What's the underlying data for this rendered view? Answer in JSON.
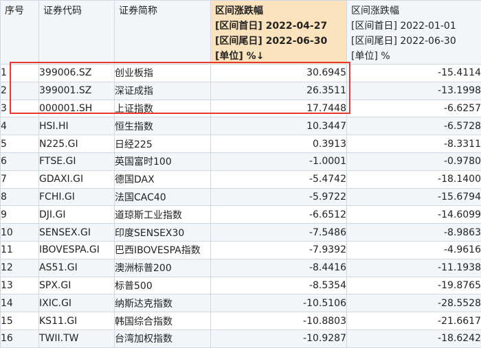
{
  "headers": {
    "idx": "序号",
    "code": "证券代码",
    "name": "证券简称",
    "col1": [
      "区间涨跌幅",
      "[区间首日] 2022-04-27",
      "[区间尾日] 2022-06-30",
      "[单位] %↓"
    ],
    "col2": [
      "区间涨跌幅",
      "[区间首日] 2022-01-01",
      "[区间尾日] 2022-06-30",
      "[单位] %"
    ]
  },
  "rows": [
    {
      "idx": "1",
      "code": "399006.SZ",
      "name": "创业板指",
      "v1": "30.6945",
      "v2": "-15.4114"
    },
    {
      "idx": "2",
      "code": "399001.SZ",
      "name": "深证成指",
      "v1": "26.3511",
      "v2": "-13.1998"
    },
    {
      "idx": "3",
      "code": "000001.SH",
      "name": "上证指数",
      "v1": "17.7448",
      "v2": "-6.6257"
    },
    {
      "idx": "4",
      "code": "HSI.HI",
      "name": "恒生指数",
      "v1": "10.3447",
      "v2": "-6.5728"
    },
    {
      "idx": "5",
      "code": "N225.GI",
      "name": "日经225",
      "v1": "0.3913",
      "v2": "-8.3311"
    },
    {
      "idx": "6",
      "code": "FTSE.GI",
      "name": "英国富时100",
      "v1": "-1.0001",
      "v2": "-0.9780"
    },
    {
      "idx": "7",
      "code": "GDAXI.GI",
      "name": "德国DAX",
      "v1": "-5.4742",
      "v2": "-18.1400"
    },
    {
      "idx": "8",
      "code": "FCHI.GI",
      "name": "法国CAC40",
      "v1": "-5.9722",
      "v2": "-15.6794"
    },
    {
      "idx": "9",
      "code": "DJI.GI",
      "name": "道琼斯工业指数",
      "v1": "-6.6512",
      "v2": "-14.6099"
    },
    {
      "idx": "10",
      "code": "SENSEX.GI",
      "name": "印度SENSEX30",
      "v1": "-7.5486",
      "v2": "-8.9863"
    },
    {
      "idx": "11",
      "code": "IBOVESPA.GI",
      "name": "巴西IBOVESPA指数",
      "v1": "-7.9392",
      "v2": "-4.9616"
    },
    {
      "idx": "12",
      "code": "AS51.GI",
      "name": "澳洲标普200",
      "v1": "-8.4416",
      "v2": "-11.1938"
    },
    {
      "idx": "13",
      "code": "SPX.GI",
      "name": "标普500",
      "v1": "-8.5354",
      "v2": "-19.8765"
    },
    {
      "idx": "14",
      "code": "IXIC.GI",
      "name": "纳斯达克指数",
      "v1": "-10.5106",
      "v2": "-28.5528"
    },
    {
      "idx": "15",
      "code": "KS11.GI",
      "name": "韩国综合指数",
      "v1": "-10.8803",
      "v2": "-21.6617"
    },
    {
      "idx": "16",
      "code": "TWII.TW",
      "name": "台湾加权指数",
      "v1": "-10.9287",
      "v2": "-18.6242"
    }
  ]
}
